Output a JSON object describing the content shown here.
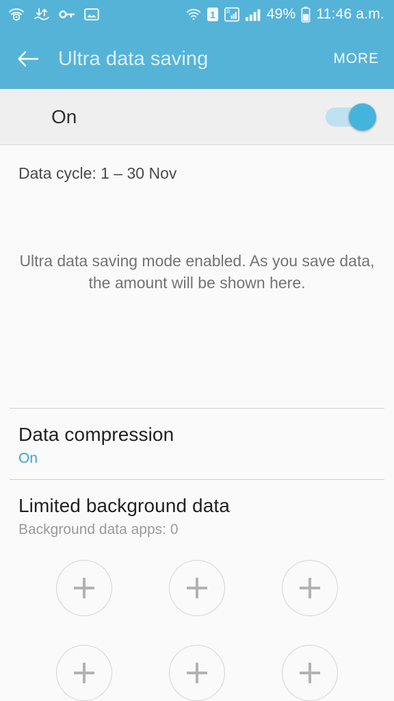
{
  "status_bar": {
    "left_icons": [
      {
        "name": "wifi-secured-icon",
        "label": "secure wifi"
      },
      {
        "name": "data-transfer-icon",
        "label": "download upload"
      },
      {
        "name": "vpn-key-icon",
        "label": "vpn"
      },
      {
        "name": "screenshot-image-icon",
        "label": "image saved"
      }
    ],
    "right_icons": [
      {
        "name": "wifi-icon",
        "label": "wifi"
      },
      {
        "name": "sim-one-icon",
        "label": "1"
      },
      {
        "name": "roaming-signal-icon",
        "label": "R"
      },
      {
        "name": "signal-bars-icon",
        "label": "signal"
      }
    ],
    "battery_percent": "49%",
    "battery_icon": "battery-icon",
    "clock": "11:46 a.m."
  },
  "app_bar": {
    "back_icon": "back-arrow-icon",
    "title": "Ultra data saving",
    "more_label": "MORE"
  },
  "master_switch": {
    "label": "On",
    "enabled": true
  },
  "main": {
    "data_cycle": "Data cycle: 1 – 30 Nov",
    "empty_state_line1": "Ultra data saving mode enabled. As you save data,",
    "empty_state_line2": "the amount will be shown here."
  },
  "sections": [
    {
      "title": "Data compression",
      "subtitle": "On",
      "subtitle_style": "accent"
    },
    {
      "title": "Limited background data",
      "subtitle": "Background data apps: 0",
      "subtitle_style": "muted"
    }
  ],
  "app_slots": [
    {
      "name": "add-app-slot-1",
      "icon": "plus-icon"
    },
    {
      "name": "add-app-slot-2",
      "icon": "plus-icon"
    },
    {
      "name": "add-app-slot-3",
      "icon": "plus-icon"
    },
    {
      "name": "add-app-slot-4",
      "icon": "plus-icon"
    },
    {
      "name": "add-app-slot-5",
      "icon": "plus-icon"
    },
    {
      "name": "add-app-slot-6",
      "icon": "plus-icon"
    }
  ],
  "colors": {
    "accent": "#55b3d8",
    "toggle_thumb": "#45b4dd",
    "toggle_track": "#bfe1f1",
    "switch_row_bg": "#efefef",
    "page_bg": "#fafafa",
    "link": "#3ba5cc"
  }
}
